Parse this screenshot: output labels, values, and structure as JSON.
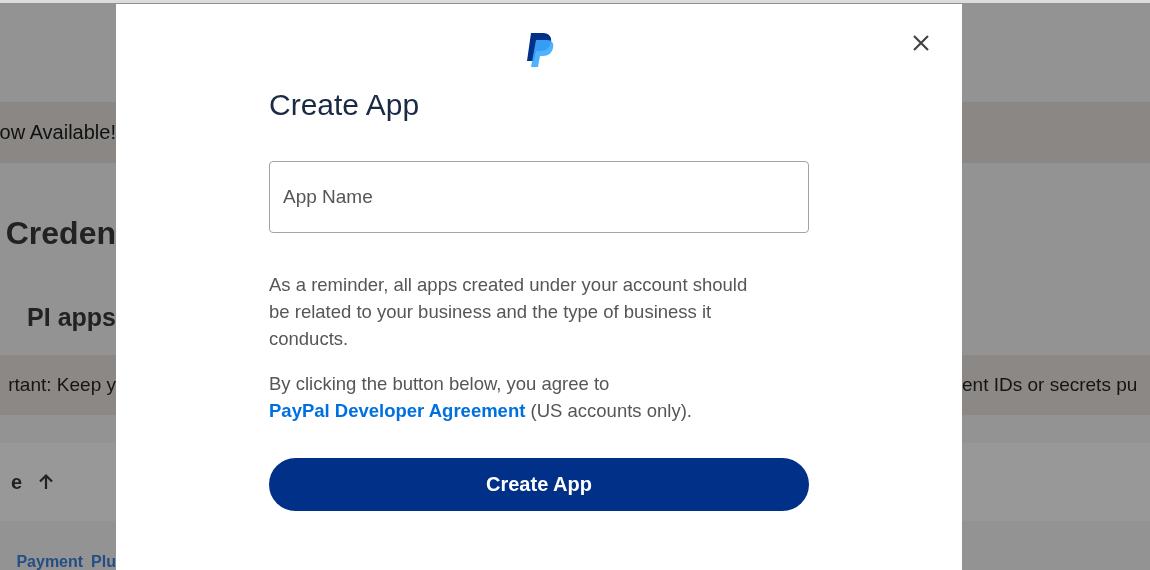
{
  "background": {
    "banner_text": "ow Available!",
    "heading": "Creden",
    "section_heading": "PI apps",
    "notice_left": "rtant: Keep y",
    "notice_right": "ent IDs or secrets pu",
    "table_header": "e",
    "links": [
      "Payment",
      "Plu"
    ]
  },
  "dialog": {
    "title": "Create App",
    "field": {
      "placeholder": "App Name"
    },
    "reminder": "As a reminder, all apps created under your account should be related to your business and the type of business it conducts.",
    "agreement": {
      "before": "By clicking the button below, you agree to",
      "link": "PayPal Developer Agreement",
      "after": "(US accounts only)."
    },
    "button": "Create App"
  }
}
